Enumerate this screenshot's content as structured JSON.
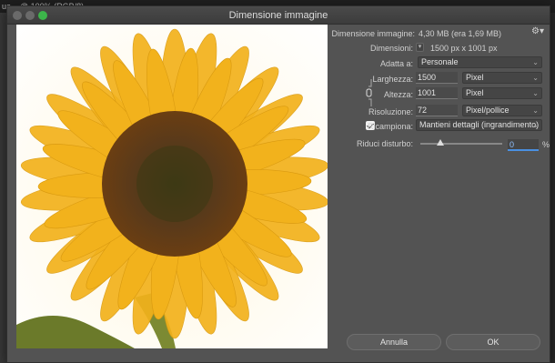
{
  "background": {
    "app_title": "ue... @ 100% (RGB/8)"
  },
  "dialog": {
    "title": "Dimensione immagine",
    "image_size_label": "Dimensione immagine:",
    "image_size_value": "4,30 MB (era 1,69 MB)",
    "dimensions_label": "Dimensioni:",
    "dimensions_value": "1500 px x 1001 px",
    "fit_label": "Adatta a:",
    "fit_value": "Personale",
    "width_label": "Larghezza:",
    "width_value": "1500",
    "width_unit": "Pixel",
    "height_label": "Altezza:",
    "height_value": "1001",
    "height_unit": "Pixel",
    "resolution_label": "Risoluzione:",
    "resolution_value": "72",
    "resolution_unit": "Pixel/pollice",
    "resample_label": "Ricampiona:",
    "resample_value": "Mantieni dettagli (ingrandimento)",
    "resample_checked": true,
    "noise_label": "Riduci disturbo:",
    "noise_value": "0",
    "noise_unit": "%",
    "cancel_label": "Annulla",
    "ok_label": "OK"
  },
  "preview": {
    "subject": "sunflower",
    "petal_color": "#f2b21c",
    "center_color": "#5a3a1a"
  }
}
